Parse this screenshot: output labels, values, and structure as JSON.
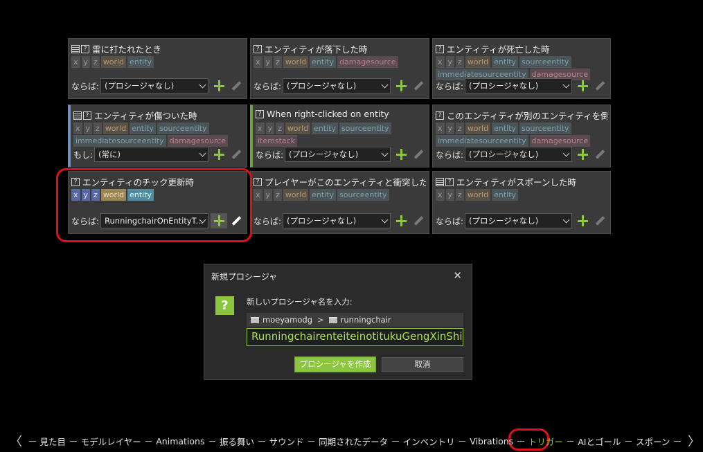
{
  "triggers": [
    {
      "title": "雷に打たれたとき",
      "icons": [
        "doc",
        "q"
      ],
      "deps": [
        "x",
        "y",
        "z",
        "world",
        "entity"
      ],
      "cond_label": "ならば:",
      "procedure": "(プロシージャなし)"
    },
    {
      "title": "エンティティが落下した時",
      "icons": [
        "q"
      ],
      "deps": [
        "x",
        "y",
        "z",
        "world",
        "entity",
        "damagesource"
      ],
      "cond_label": "ならば:",
      "procedure": "(プロシージャなし)"
    },
    {
      "title": "エンティティが死亡した時",
      "icons": [
        "q"
      ],
      "deps": [
        "x",
        "y",
        "z",
        "world",
        "entity",
        "sourceentity",
        "immediatesourceentity",
        "damagesource"
      ],
      "cond_label": "ならば:",
      "procedure": "(プロシージャなし)"
    },
    {
      "title": "エンティティが傷ついた時",
      "icons": [
        "doc",
        "q"
      ],
      "deps": [
        "x",
        "y",
        "z",
        "world",
        "entity",
        "sourceentity",
        "immediatesourceentity",
        "damagesource"
      ],
      "cond_label": "もし:",
      "procedure": "(常に)"
    },
    {
      "title": "When right-clicked on entity",
      "icons": [
        "q"
      ],
      "deps": [
        "x",
        "y",
        "z",
        "world",
        "entity",
        "sourceentity",
        "itemstack"
      ],
      "cond_label": "ならば:",
      "procedure": "(プロシージャなし)"
    },
    {
      "title": "このエンティティが別のエンティティを倒した時",
      "icons": [
        "q"
      ],
      "deps": [
        "x",
        "y",
        "z",
        "world",
        "entity",
        "sourceentity",
        "immediatesourceentity",
        "damagesource"
      ],
      "cond_label": "ならば:",
      "procedure": "(プロシージャなし)"
    },
    {
      "title": "エンティティのチック更新時",
      "icons": [
        "q"
      ],
      "deps": [
        "x",
        "y",
        "z",
        "world",
        "entity"
      ],
      "cond_label": "ならば:",
      "procedure": "RunningchairOnEntityT..."
    },
    {
      "title": "プレイヤーがこのエンティティと衝突したとき",
      "icons": [
        "q"
      ],
      "deps": [
        "x",
        "y",
        "z",
        "world",
        "entity",
        "sourceentity"
      ],
      "cond_label": "ならば:",
      "procedure": "(プロシージャなし)"
    },
    {
      "title": "エンティティがスポーンした時",
      "icons": [
        "doc",
        "q"
      ],
      "deps": [
        "x",
        "y",
        "z",
        "world",
        "entity"
      ],
      "cond_label": "ならば:",
      "procedure": "(プロシージャなし)"
    }
  ],
  "dialog": {
    "title": "新規プロシージャ",
    "close": "✕",
    "icon": "?",
    "prompt": "新しいプロシージャ名を入力:",
    "path": [
      "moeyamodg",
      "runningchair"
    ],
    "path_sep": ">",
    "name_value": "RunningchairenteiteinotitukuGengXinShi",
    "create_label": "プロシージャを作成",
    "cancel_label": "取消"
  },
  "nav": {
    "prev": "〈",
    "next": "〉",
    "items": [
      "見た目",
      "モデルレイヤー",
      "Animations",
      "振る舞い",
      "サウンド",
      "同期されたデータ",
      "インベントリ",
      "Vibrations",
      "トリガー",
      "AIとゴール",
      "スポーン"
    ],
    "active": "トリガー"
  },
  "colors": {
    "accent": "#8cc63e",
    "highlight_ring": "#e0101a"
  }
}
